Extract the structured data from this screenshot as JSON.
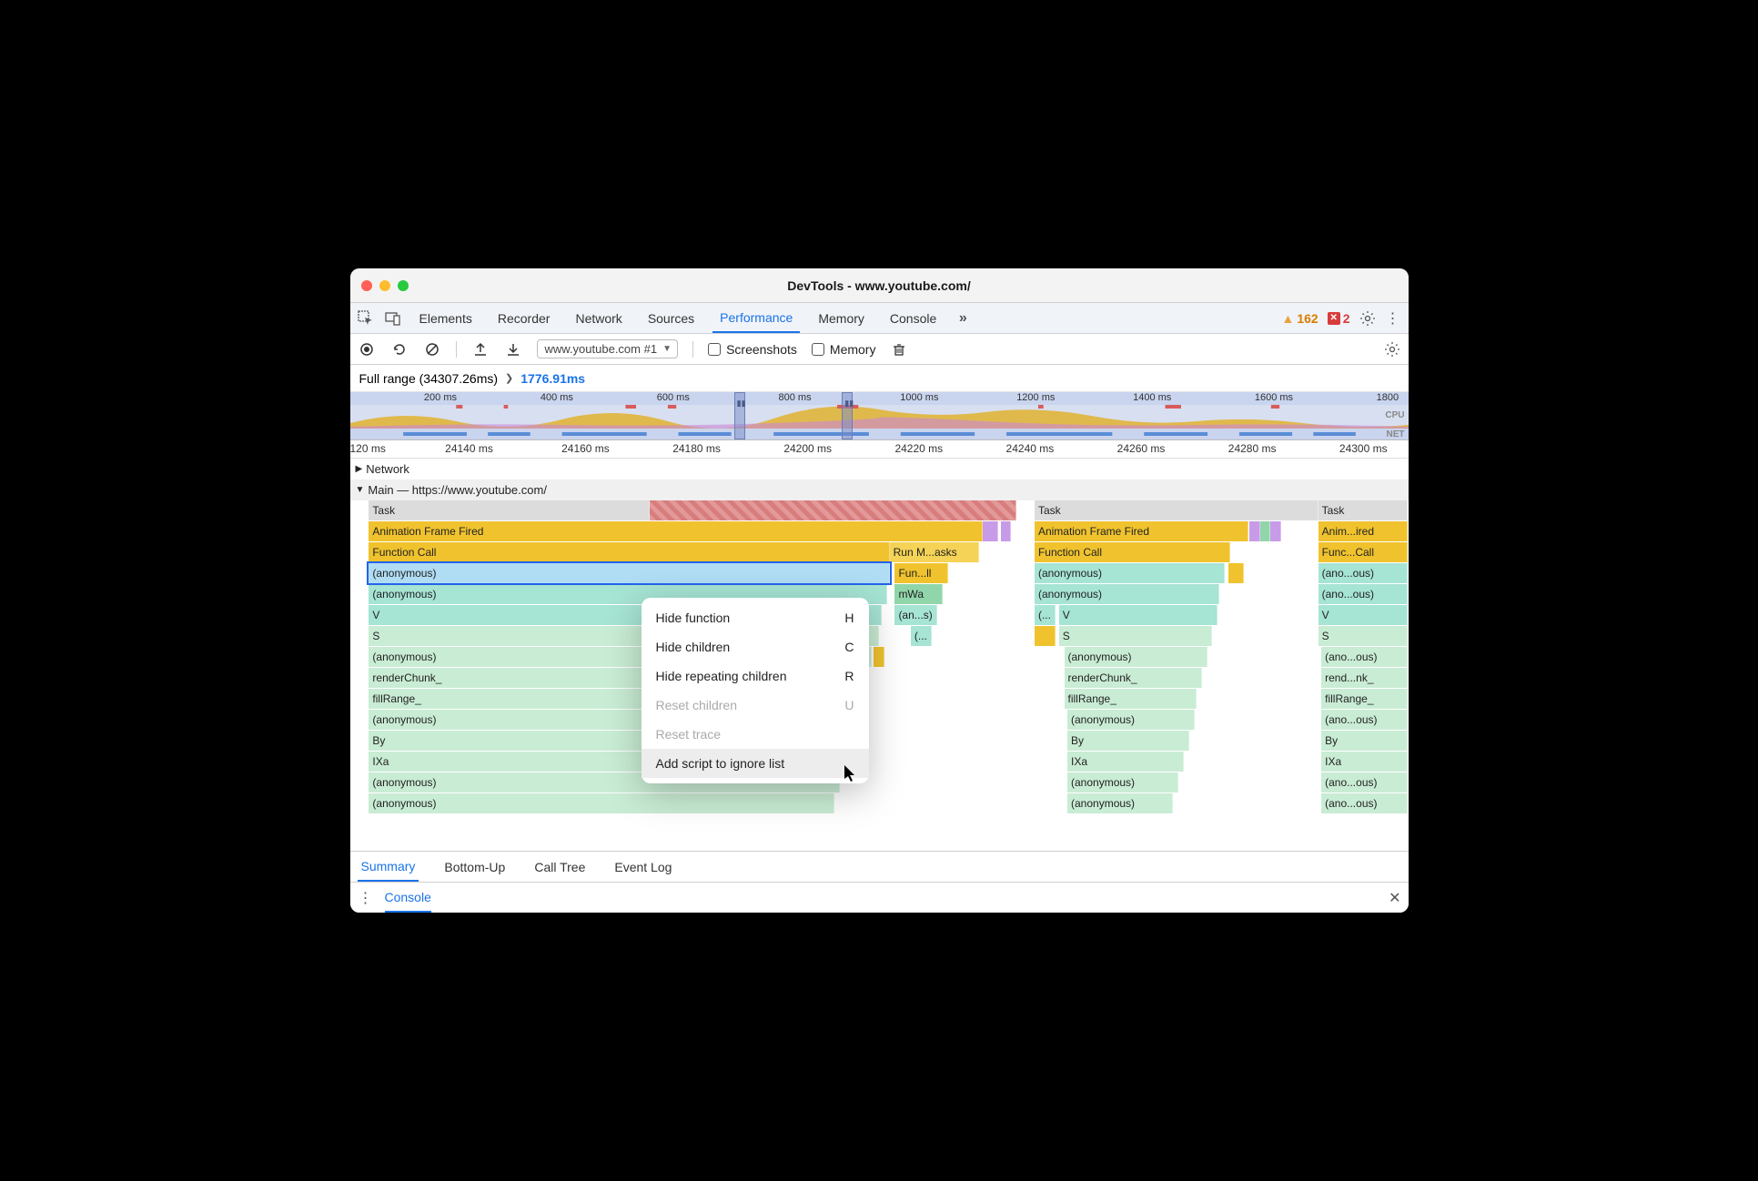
{
  "title": "DevTools - www.youtube.com/",
  "tabs": [
    "Elements",
    "Recorder",
    "Network",
    "Sources",
    "Performance",
    "Memory",
    "Console"
  ],
  "active_tab": "Performance",
  "warnings": 162,
  "errors": 2,
  "recording_name": "www.youtube.com #1",
  "checkboxes": {
    "screenshots": "Screenshots",
    "memory": "Memory"
  },
  "breadcrumb": {
    "full": "Full range (34307.26ms)",
    "current": "1776.91ms"
  },
  "overview_ticks": [
    "200 ms",
    "400 ms",
    "600 ms",
    "800 ms",
    "1000 ms",
    "1200 ms",
    "1400 ms",
    "1600 ms",
    "1800 ms"
  ],
  "overview_labels": {
    "cpu": "CPU",
    "net": "NET"
  },
  "ruler_ticks": [
    "120 ms",
    "24140 ms",
    "24160 ms",
    "24180 ms",
    "24200 ms",
    "24220 ms",
    "24240 ms",
    "24260 ms",
    "24280 ms",
    "24300 ms"
  ],
  "tracks": {
    "network": "Network",
    "main": "Main — https://www.youtube.com/"
  },
  "flame": {
    "col1": {
      "task": "Task",
      "anim": "Animation Frame Fired",
      "func": "Function Call",
      "run": "Run M...asks",
      "anon_sel": "(anonymous)",
      "fun2": "Fun...ll",
      "anon2": "(anonymous)",
      "mwa": "mWa",
      "v": "V",
      "ans": "(an...s)",
      "s": "S",
      "paren": "(...",
      "anon3": "(anonymous)",
      "render": "renderChunk_",
      "fill": "fillRange_",
      "anon4": "(anonymous)",
      "by": "By",
      "ixa": "IXa",
      "anon5": "(anonymous)",
      "anon6": "(anonymous)"
    },
    "col2": {
      "task": "Task",
      "anim": "Animation Frame Fired",
      "func": "Function Call",
      "anon1": "(anonymous)",
      "anon2": "(anonymous)",
      "paren": "(...",
      "v": "V",
      "s": "S",
      "anon3": "(anonymous)",
      "render": "renderChunk_",
      "fill": "fillRange_",
      "anon4": "(anonymous)",
      "by": "By",
      "ixa": "IXa",
      "anon5": "(anonymous)",
      "anon6": "(anonymous)"
    },
    "col3": {
      "task": "Task",
      "anim": "Anim...ired",
      "func": "Func...Call",
      "anon1": "(ano...ous)",
      "anon2": "(ano...ous)",
      "v": "V",
      "s": "S",
      "anon3": "(ano...ous)",
      "render": "rend...nk_",
      "fill": "fillRange_",
      "anon4": "(ano...ous)",
      "by": "By",
      "ixa": "IXa",
      "anon5": "(ano...ous)",
      "anon6": "(ano...ous)"
    }
  },
  "context_menu": [
    {
      "label": "Hide function",
      "shortcut": "H",
      "disabled": false
    },
    {
      "label": "Hide children",
      "shortcut": "C",
      "disabled": false
    },
    {
      "label": "Hide repeating children",
      "shortcut": "R",
      "disabled": false
    },
    {
      "label": "Reset children",
      "shortcut": "U",
      "disabled": true
    },
    {
      "label": "Reset trace",
      "shortcut": "",
      "disabled": true
    },
    {
      "label": "Add script to ignore list",
      "shortcut": "",
      "disabled": false,
      "highlighted": true
    }
  ],
  "bottom_tabs": [
    "Summary",
    "Bottom-Up",
    "Call Tree",
    "Event Log"
  ],
  "active_bottom_tab": "Summary",
  "console_label": "Console"
}
